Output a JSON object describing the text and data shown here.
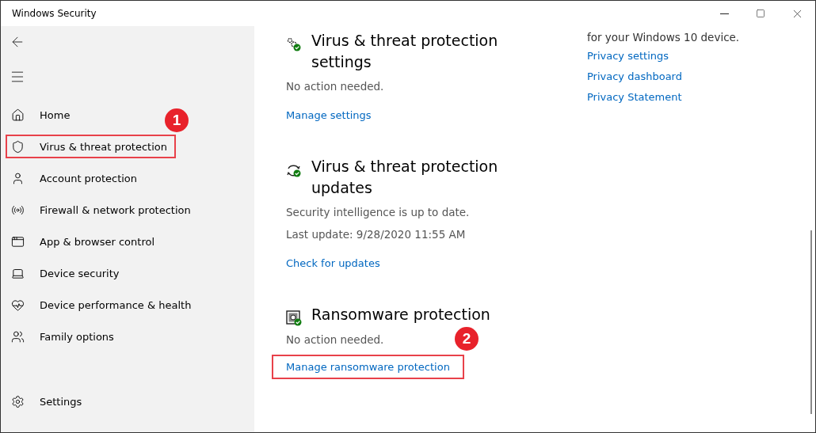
{
  "window": {
    "title": "Windows Security"
  },
  "sidebar": {
    "items": [
      {
        "kind": "home",
        "label": "Home",
        "selected": false
      },
      {
        "kind": "shield",
        "label": "Virus & threat protection",
        "selected": true,
        "annotation": "1"
      },
      {
        "kind": "account",
        "label": "Account protection",
        "selected": false
      },
      {
        "kind": "firewall",
        "label": "Firewall & network protection",
        "selected": false
      },
      {
        "kind": "app",
        "label": "App & browser control",
        "selected": false
      },
      {
        "kind": "device",
        "label": "Device security",
        "selected": false
      },
      {
        "kind": "health",
        "label": "Device performance & health",
        "selected": false
      },
      {
        "kind": "family",
        "label": "Family options",
        "selected": false
      }
    ],
    "footer": {
      "kind": "settings",
      "label": "Settings",
      "selected": false
    }
  },
  "sections": [
    {
      "kind": "settings",
      "title": "Virus & threat protection settings",
      "lines": [
        "No action needed."
      ],
      "link": {
        "label": "Manage settings"
      }
    },
    {
      "kind": "updates",
      "title": "Virus & threat protection updates",
      "lines": [
        "Security intelligence is up to date.",
        "Last update: 9/28/2020 11:55 AM"
      ],
      "link": {
        "label": "Check for updates"
      }
    },
    {
      "kind": "ransomware",
      "title": "Ransomware protection",
      "lines": [
        "No action needed."
      ],
      "link": {
        "label": "Manage ransomware protection",
        "annotation": "2"
      }
    }
  ],
  "privacy": {
    "text": "for your Windows 10 device.",
    "links": [
      "Privacy settings",
      "Privacy dashboard",
      "Privacy Statement"
    ]
  }
}
